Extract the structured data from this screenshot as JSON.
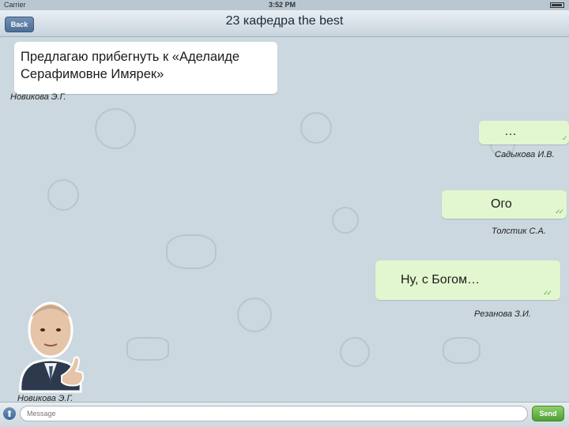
{
  "status_bar": {
    "carrier": "Carrier",
    "time": "3:52 PM"
  },
  "nav": {
    "back_label": "Back",
    "title": "23 кафедра the best"
  },
  "messages": [
    {
      "text_line1": "Предлагаю прибегнуть к «Аделаиде",
      "text_line2": "Серафимовне Имярек»",
      "signature": "Новикова Э.Г.",
      "direction": "in"
    },
    {
      "text": "…",
      "signature": "Садыкова И.В.",
      "direction": "out"
    },
    {
      "text": "Ого",
      "signature": "Толстик С.А.",
      "direction": "out"
    },
    {
      "text": "Ну, с Богом…",
      "signature": "Резанова З.И.",
      "direction": "out"
    }
  ],
  "sticker": {
    "signature": "Новикова Э.Г.",
    "icon": "man-thumbs-up-sticker-icon"
  },
  "input": {
    "placeholder": "Message",
    "send_label": "Send",
    "attach_icon": "attach-arrow-icon"
  },
  "colors": {
    "incoming_bubble": "#ffffff",
    "outgoing_bubble": "#e2f7cf",
    "chat_background": "#cbd8df",
    "send_button": "#5fae44"
  }
}
